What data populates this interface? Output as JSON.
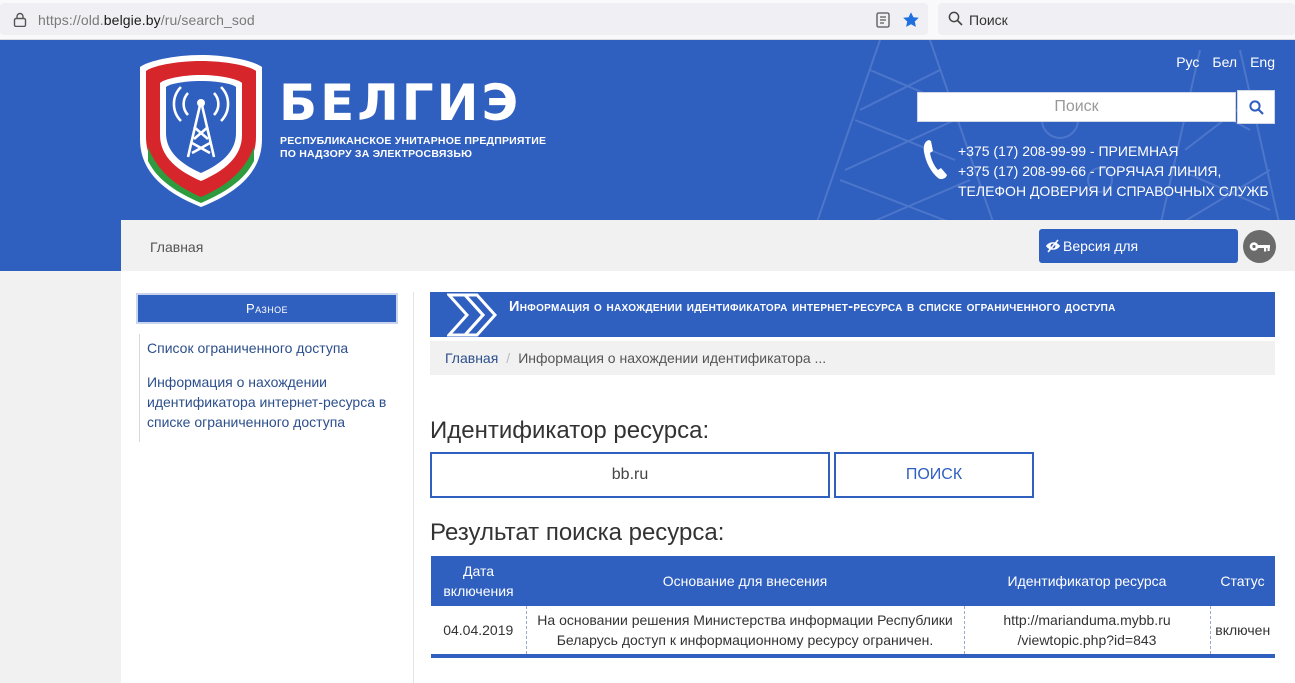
{
  "browser": {
    "url_prefix": "https://old.",
    "url_domain": "belgie.by",
    "url_path": "/ru/search_sod",
    "search_placeholder": "Поиск"
  },
  "header": {
    "logo_title": "БЕЛГИЭ",
    "logo_subtitle_line1": "Республиканское унитарное предприятие",
    "logo_subtitle_line2": "по надзору за электросвязью",
    "languages": [
      "Рус",
      "Бел",
      "Eng"
    ],
    "search_placeholder": "Поиск",
    "phones": [
      "+375 (17) 208-99-99 - ПРИЕМНАЯ",
      "+375 (17) 208-99-66 - ГОРЯЧАЯ ЛИНИЯ,",
      "ТЕЛЕФОН ДОВЕРИЯ И СПРАВОЧНЫХ СЛУЖБ"
    ]
  },
  "nav": {
    "home": "Главная",
    "low_vision": "Версия для слабовидящих"
  },
  "sidebar": {
    "title": "Разное",
    "links": [
      "Список ограниченного доступа",
      "Информация о нахождении идентификатора интернет-ресурса в списке ограниченного доступа"
    ]
  },
  "content": {
    "page_title": "Информация о нахождении идентификатора интернет-ресурса в списке ограниченного доступа",
    "breadcrumb_home": "Главная",
    "breadcrumb_sep": "/",
    "breadcrumb_current": "Информация о нахождении идентификатора ...",
    "id_label": "Идентификатор ресурса:",
    "id_value": "bb.ru",
    "search_button": "ПОИСК",
    "result_label": "Результат поиска ресурса:",
    "table": {
      "headers": [
        "Дата включения",
        "Основание для внесения",
        "Идентификатор ресурса",
        "Статус"
      ],
      "rows": [
        {
          "date": "04.04.2019",
          "basis": "На основании решения Министерства информации Республики Беларусь доступ к информационному ресурсу ограничен.",
          "identifier": "http://marianduma.mybb.ru /viewtopic.php?id=843",
          "status": "включен"
        }
      ]
    }
  },
  "colors": {
    "brand_blue": "#2f5fbf",
    "status_red": "#e00000"
  }
}
